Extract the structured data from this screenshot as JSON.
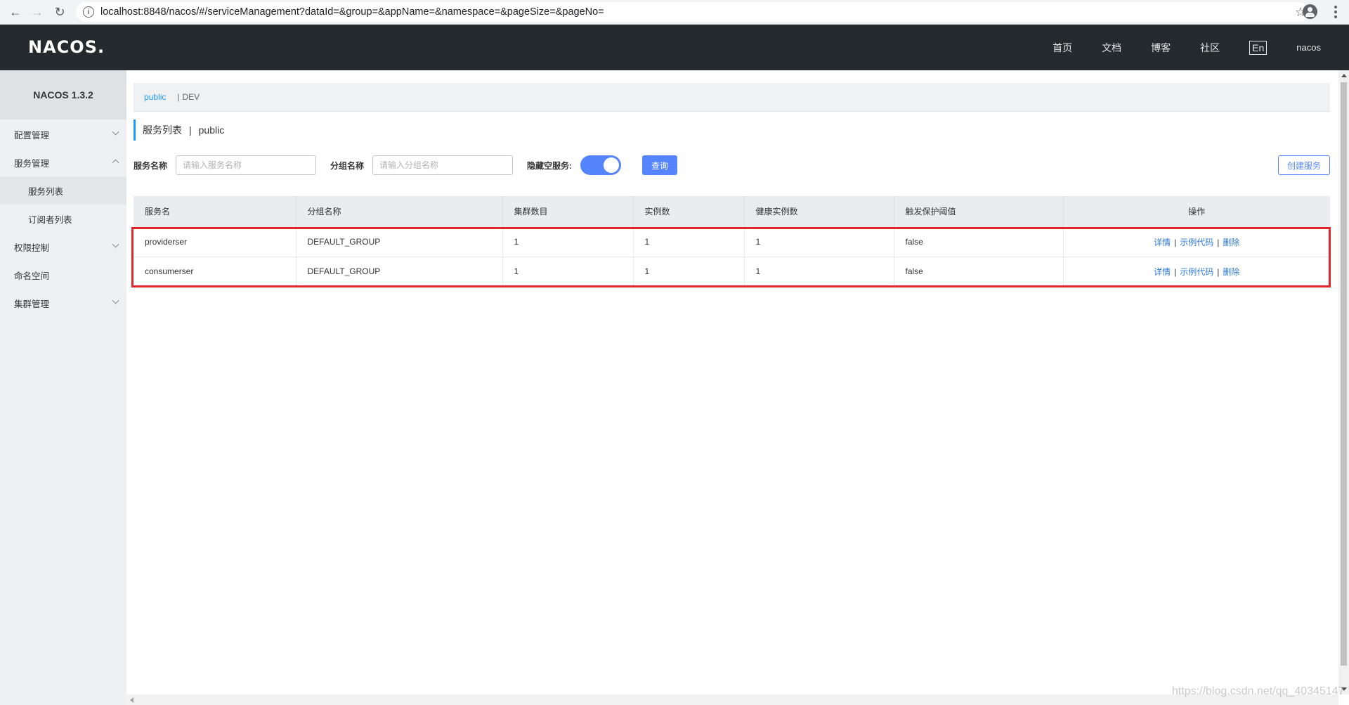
{
  "browser": {
    "url": "localhost:8848/nacos/#/serviceManagement?dataId=&group=&appName=&namespace=&pageSize=&pageNo="
  },
  "header": {
    "logo": "NACOS.",
    "nav": [
      "首页",
      "文档",
      "博客",
      "社区"
    ],
    "lang": "En",
    "user": "nacos"
  },
  "sidebar": {
    "title": "NACOS 1.3.2",
    "items": [
      {
        "label": "配置管理"
      },
      {
        "label": "服务管理"
      },
      {
        "label": "服务列表"
      },
      {
        "label": "订阅者列表"
      },
      {
        "label": "权限控制"
      },
      {
        "label": "命名空间"
      },
      {
        "label": "集群管理"
      }
    ]
  },
  "namespace": {
    "active": "public",
    "separator": "|",
    "other": "DEV"
  },
  "page": {
    "title": "服务列表",
    "sep": "|",
    "namespace": "public"
  },
  "filters": {
    "service_label": "服务名称",
    "service_placeholder": "请输入服务名称",
    "group_label": "分组名称",
    "group_placeholder": "请输入分组名称",
    "hide_empty_label": "隐藏空服务:",
    "hide_empty_on": true,
    "query_label": "查询",
    "create_label": "创建服务"
  },
  "table": {
    "columns": [
      "服务名",
      "分组名称",
      "集群数目",
      "实例数",
      "健康实例数",
      "触发保护阈值",
      "操作"
    ],
    "rows": [
      {
        "name": "providerser",
        "group": "DEFAULT_GROUP",
        "clusters": "1",
        "instances": "1",
        "healthy": "1",
        "threshold": "false"
      },
      {
        "name": "consumerser",
        "group": "DEFAULT_GROUP",
        "clusters": "1",
        "instances": "1",
        "healthy": "1",
        "threshold": "false"
      }
    ],
    "ops": {
      "detail": "详情",
      "sample": "示例代码",
      "delete": "删除",
      "sep": "|"
    }
  },
  "watermark": "https://blog.csdn.net/qq_40345147",
  "colors": {
    "accent": "#5584ff",
    "link": "#2b79d6",
    "highlight": "#e0272c",
    "header_bg": "#252a2f"
  }
}
